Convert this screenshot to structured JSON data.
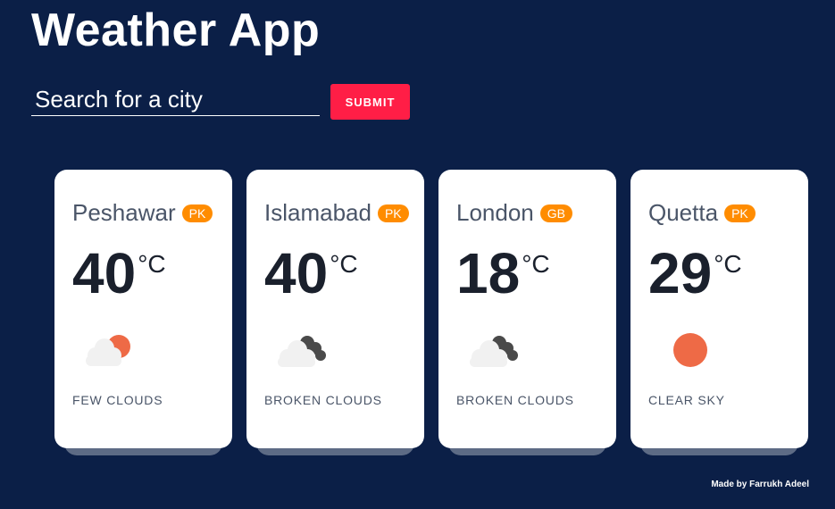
{
  "app": {
    "title": "Weather App"
  },
  "search": {
    "placeholder": "Search for a city",
    "value": "",
    "submit_label": "SUBMIT"
  },
  "cards": [
    {
      "city": "Peshawar",
      "country": "PK",
      "temp": "40",
      "unit": "°C",
      "icon": "few-clouds-icon",
      "description": "FEW CLOUDS"
    },
    {
      "city": "Islamabad",
      "country": "PK",
      "temp": "40",
      "unit": "°C",
      "icon": "broken-clouds-icon",
      "description": "BROKEN CLOUDS"
    },
    {
      "city": "London",
      "country": "GB",
      "temp": "18",
      "unit": "°C",
      "icon": "broken-clouds-icon",
      "description": "BROKEN CLOUDS"
    },
    {
      "city": "Quetta",
      "country": "PK",
      "temp": "29",
      "unit": "°C",
      "icon": "clear-sky-icon",
      "description": "CLEAR SKY"
    }
  ],
  "footer": {
    "credit": "Made by Farrukh Adeel"
  },
  "colors": {
    "background": "#0b1f47",
    "accent": "#ff1e46",
    "badge": "#ff8c00",
    "sun": "#ee6a46"
  }
}
